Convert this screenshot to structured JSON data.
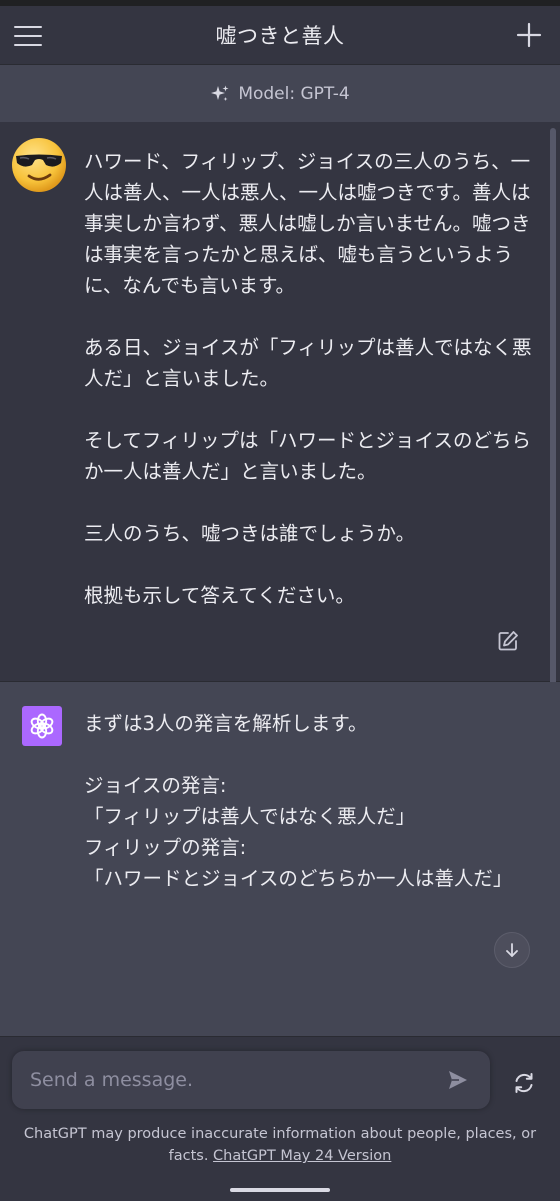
{
  "header": {
    "title": "嘘つきと善人"
  },
  "model_bar": {
    "label": "Model: GPT-4"
  },
  "user_message": {
    "text": "ハワード、フィリップ、ジョイスの三人のうち、一人は善人、一人は悪人、一人は嘘つきです。善人は事実しか言わず、悪人は嘘しか言いません。嘘つきは事実を言ったかと思えば、嘘も言うというように、なんでも言います。\n\nある日、ジョイスが「フィリップは善人ではなく悪人だ」と言いました。\n\nそしてフィリップは「ハワードとジョイスのどちらか一人は善人だ」と言いました。\n\n三人のうち、嘘つきは誰でしょうか。\n\n根拠も示して答えてください。"
  },
  "assistant_message": {
    "text": "まずは3人の発言を解析します。\n\nジョイスの発言:\n「フィリップは善人ではなく悪人だ」\nフィリップの発言:\n「ハワードとジョイスのどちらか一人は善人だ」"
  },
  "composer": {
    "placeholder": "Send a message."
  },
  "disclaimer": {
    "text": "ChatGPT may produce inaccurate information about people, places, or facts. ",
    "link": "ChatGPT May 24 Version"
  },
  "colors": {
    "background": "#343541",
    "assistant_bg": "#444654",
    "gpt_avatar": "#ab68ff",
    "input_bg": "#40414f"
  },
  "icons": {
    "menu": "hamburger-menu-icon",
    "new_chat": "plus-icon",
    "model": "sparkle-icon",
    "user_avatar": "sunglasses-emoji-icon",
    "edit": "edit-icon",
    "gpt_avatar": "openai-logo-icon",
    "scroll_down": "arrow-down-icon",
    "send": "send-icon",
    "regenerate": "regenerate-icon"
  }
}
